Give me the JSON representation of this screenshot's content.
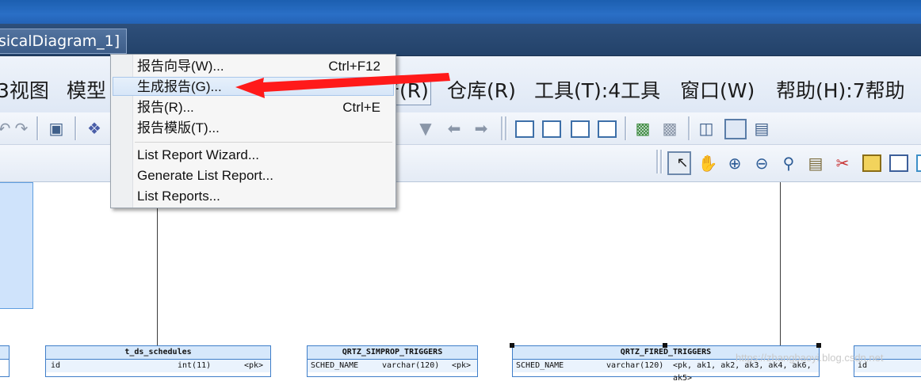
{
  "window": {
    "doc_tab_title": "sicalDiagram_1]"
  },
  "menubar": {
    "items": [
      {
        "label": "3视图"
      },
      {
        "label": "模型"
      },
      {
        "label": "告(R)"
      },
      {
        "label": "仓库(R)"
      },
      {
        "label": "工具(T):4工具"
      },
      {
        "label": "窗口(W)"
      },
      {
        "label": "帮助(H):7帮助"
      }
    ]
  },
  "dropdown": {
    "items": [
      {
        "label": "报告向导(W)...",
        "shortcut": "Ctrl+F12"
      },
      {
        "label": "生成报告(G)...",
        "shortcut": ""
      },
      {
        "label": "报告(R)...",
        "shortcut": "Ctrl+E"
      },
      {
        "label": "报告模版(T)...",
        "shortcut": ""
      },
      {
        "label": "List Report Wizard...",
        "shortcut": ""
      },
      {
        "label": "Generate List Report...",
        "shortcut": ""
      },
      {
        "label": "List Reports...",
        "shortcut": ""
      }
    ]
  },
  "diagram": {
    "tables": [
      {
        "title": "t_ds_schedules",
        "row": {
          "name": "id",
          "type": "int(11)",
          "key": "<pk>"
        }
      },
      {
        "title": "QRTZ_SIMPROP_TRIGGERS",
        "row": {
          "name": "SCHED_NAME",
          "type": "varchar(120)",
          "key": "<pk>"
        }
      },
      {
        "title": "QRTZ_FIRED_TRIGGERS",
        "row": {
          "name": "SCHED_NAME",
          "type": "varchar(120)",
          "key": "<pk, ak1, ak2, ak3, ak4, ak6, ak5>"
        }
      },
      {
        "title": "",
        "row": {
          "name": "id",
          "type": "",
          "key": ""
        }
      }
    ]
  },
  "watermark": "https://zhangbaoyi.blog.csdn.net",
  "colors": {
    "highlight": "#d7e6f8",
    "annotation_arrow": "#ff1a1a",
    "table_border": "#3f7ec9"
  }
}
